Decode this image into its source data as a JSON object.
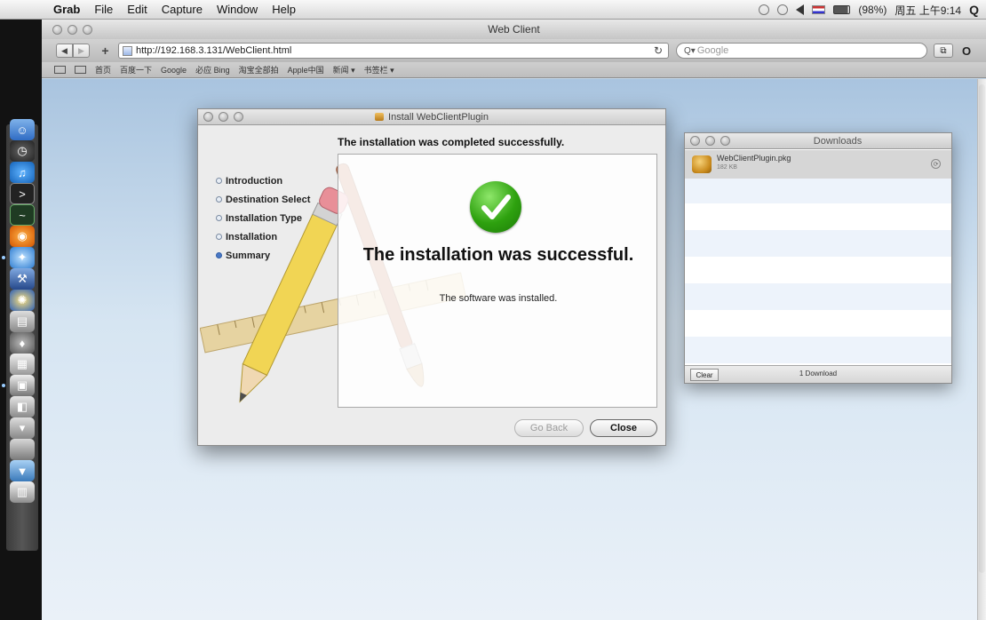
{
  "menubar": {
    "app": "Grab",
    "menus": [
      "File",
      "Edit",
      "Capture",
      "Window",
      "Help"
    ],
    "battery": "(98%)",
    "clock": "周五 上午9:14"
  },
  "browser": {
    "title": "Web Client",
    "url": "http://192.168.3.131/WebClient.html",
    "search_placeholder": "Google",
    "bookmarks": [
      "首页",
      "百度一下",
      "Google",
      "必应 Bing",
      "淘宝全部拍",
      "Apple中国",
      "新闻 ▾",
      "书签栏 ▾"
    ]
  },
  "installer": {
    "title": "Install WebClientPlugin",
    "heading": "The installation was completed successfully.",
    "steps": [
      "Introduction",
      "Destination Select",
      "Installation Type",
      "Installation",
      "Summary"
    ],
    "current_step": "Summary",
    "main_message": "The installation was successful.",
    "sub_message": "The software was installed.",
    "go_back_label": "Go Back",
    "close_label": "Close"
  },
  "downloads": {
    "title": "Downloads",
    "item_name": "WebClientPlugin.pkg",
    "item_size": "182 KB",
    "clear_label": "Clear",
    "count_label": "1 Download"
  },
  "colors": {
    "success_green": "#2ea10f",
    "desktop_blue": "#a9c4df"
  }
}
